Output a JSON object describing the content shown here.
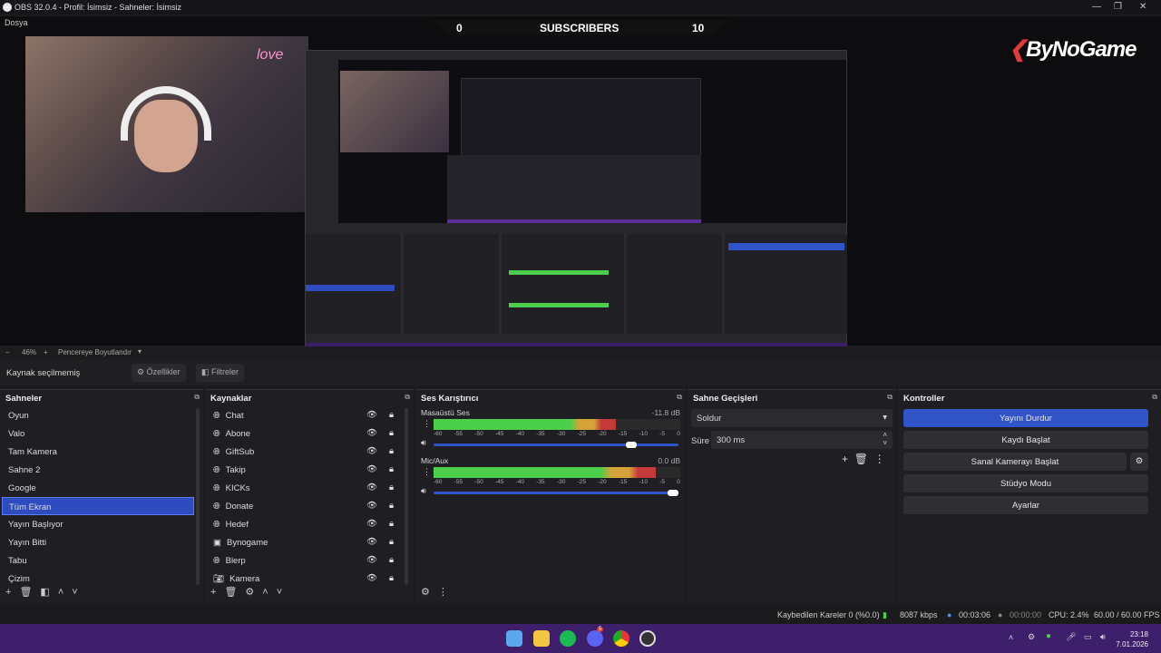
{
  "window": {
    "title": "OBS 32.0.4 - Profil: İsimsiz - Sahneler: İsimsiz",
    "menu_partial": "Dosya"
  },
  "overlay": {
    "subs_left": "0",
    "subs_label": "SUBSCRIBERS",
    "subs_right": "10",
    "brand": "ByNoGame",
    "love_sign": "love"
  },
  "zoom": {
    "minus": "−",
    "value": "46%",
    "plus": "+",
    "fit_label": "Pencereye Boyutlandır"
  },
  "source_bar": {
    "label": "Kaynak seçilmemiş",
    "properties": "Özellikler",
    "filters": "Filtreler"
  },
  "scenes": {
    "title": "Sahneler",
    "items": [
      "Oyun",
      "Valo",
      "Tam Kamera",
      "Sahne 2",
      "Google",
      "Tüm Ekran",
      "Yayın Başlıyor",
      "Yayın Bitti",
      "Tabu",
      "Çizim"
    ],
    "selected": "Tüm Ekran"
  },
  "sources": {
    "title": "Kaynaklar",
    "items": [
      {
        "name": "Chat",
        "icon": "globe-icon"
      },
      {
        "name": "Abone",
        "icon": "globe-icon"
      },
      {
        "name": "GiftSub",
        "icon": "globe-icon"
      },
      {
        "name": "Takip",
        "icon": "globe-icon"
      },
      {
        "name": "KICKs",
        "icon": "globe-icon"
      },
      {
        "name": "Donate",
        "icon": "globe-icon"
      },
      {
        "name": "Hedef",
        "icon": "globe-icon"
      },
      {
        "name": "Bynogame",
        "icon": "image-icon"
      },
      {
        "name": "Blerp",
        "icon": "globe-icon"
      },
      {
        "name": "Kamera",
        "icon": "camera-icon"
      }
    ]
  },
  "mixer": {
    "title": "Ses Karıştırıcı",
    "channels": [
      {
        "name": "Masaüstü Ses",
        "db": "-11.8 dB",
        "level": 0.74,
        "volume": 0.82
      },
      {
        "name": "Mic/Aux",
        "db": "0.0 dB",
        "level": 0.9,
        "volume": 1.0
      }
    ],
    "ticks": [
      "-60",
      "-55",
      "-50",
      "-45",
      "-40",
      "-35",
      "-30",
      "-25",
      "-20",
      "-15",
      "-10",
      "-5",
      "0"
    ]
  },
  "transitions": {
    "title": "Sahne Geçişleri",
    "type": "Soldur",
    "duration_label": "Süre",
    "duration": "300 ms"
  },
  "controls": {
    "title": "Kontroller",
    "buttons": [
      "Yayını Durdur",
      "Kaydı Başlat",
      "Sanal Kamerayı Başlat",
      "Stüdyo Modu",
      "Ayarlar"
    ]
  },
  "status": {
    "dropped": "Kaybedilen Kareler 0 (%0.0)",
    "bitrate": "8087 kbps",
    "stream_time": "00:03:06",
    "rec_time": "00:00:00",
    "cpu": "CPU: 2.4%",
    "fps": "60.00 / 60.00 FPS"
  },
  "taskbar": {
    "time": "23:18",
    "date": "7.01.2026",
    "discord_badge": "5"
  },
  "colors": {
    "accent": "#3155c9",
    "taskbar": "#3e1f6c"
  }
}
